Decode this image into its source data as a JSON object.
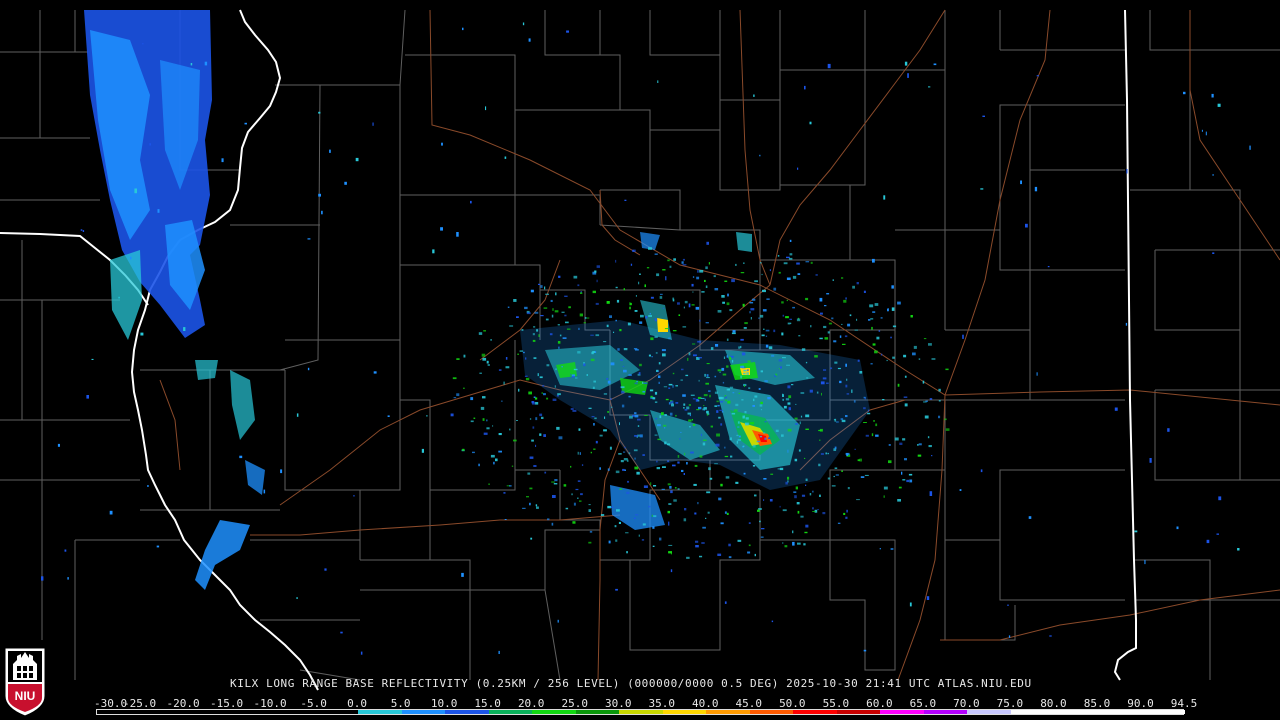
{
  "product": {
    "title": "KILX LONG RANGE BASE REFLECTIVITY (0.25KM / 256 LEVEL) (000000/0000 0.5 DEG) 2025-10-30 21:41 UTC  ATLAS.NIU.EDU"
  },
  "logo": {
    "text": "NIU",
    "color": "#c8102e"
  },
  "legend": {
    "labels": [
      "-30.0",
      "-25.0",
      "-20.0",
      "-15.0",
      "-10.0",
      "-5.0",
      "0.0",
      "5.0",
      "10.0",
      "15.0",
      "20.0",
      "25.0",
      "30.0",
      "35.0",
      "40.0",
      "45.0",
      "50.0",
      "55.0",
      "60.0",
      "65.0",
      "70.0",
      "75.0",
      "80.0",
      "85.0",
      "90.0",
      "94.5"
    ],
    "colors": [
      "#000000",
      "#000000",
      "#000000",
      "#000000",
      "#000000",
      "#000000",
      "#28c8d8",
      "#1e90ff",
      "#1c54e8",
      "#0ab05a",
      "#12d812",
      "#0a960a",
      "#c8d800",
      "#ffd700",
      "#ff9a00",
      "#ff5a00",
      "#ff0000",
      "#c80000",
      "#ff00ff",
      "#b400ff",
      "#c8c8ff",
      "#ffffff",
      "#ffffff",
      "#ffffff",
      "#ffffff"
    ]
  },
  "map_colors": {
    "county_lines": "#5f5f5f",
    "state_lines": "#ffffff",
    "roads": "#8a4a2a"
  }
}
